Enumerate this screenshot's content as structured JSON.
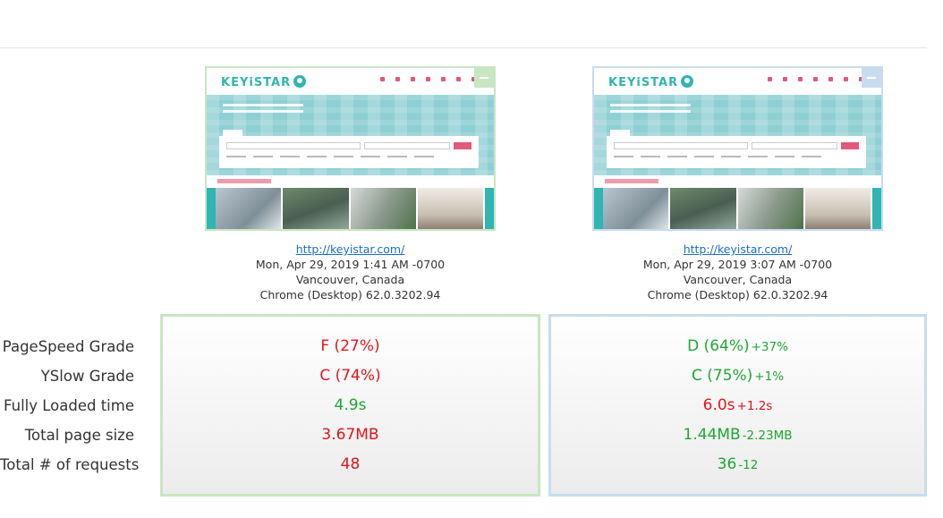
{
  "colors": {
    "bad": "#e0161b",
    "good": "#1fa734",
    "left_border": "#c8e6c1",
    "right_border": "#c7dcef",
    "link": "#1b6fc4"
  },
  "metric_labels": [
    "PageSpeed Grade",
    "YSlow Grade",
    "Fully Loaded time",
    "Total page size",
    "Total # of requests"
  ],
  "left_report": {
    "url": "http://keyistar.com/",
    "date": "Mon, Apr 29, 2019 1:41 AM -0700",
    "location": "Vancouver, Canada",
    "browser": "Chrome (Desktop) 62.0.3202.94",
    "site_logo": "KEYiSTAR",
    "metrics": [
      {
        "value": "F (27%)",
        "status": "bad"
      },
      {
        "value": "C (74%)",
        "status": "bad"
      },
      {
        "value": "4.9s",
        "status": "good"
      },
      {
        "value": "3.67MB",
        "status": "bad"
      },
      {
        "value": "48",
        "status": "bad"
      }
    ]
  },
  "right_report": {
    "url": "http://keyistar.com/",
    "date": "Mon, Apr 29, 2019 3:07 AM -0700",
    "location": "Vancouver, Canada",
    "browser": "Chrome (Desktop) 62.0.3202.94",
    "site_logo": "KEYiSTAR",
    "metrics": [
      {
        "value": "D (64%)",
        "delta": "+37%",
        "status": "good"
      },
      {
        "value": "C (75%)",
        "delta": "+1%",
        "status": "good"
      },
      {
        "value": "6.0s",
        "delta": "+1.2s",
        "status": "bad"
      },
      {
        "value": "1.44MB",
        "delta": "-2.23MB",
        "status": "good"
      },
      {
        "value": "36",
        "delta": "-12",
        "status": "good"
      }
    ]
  }
}
